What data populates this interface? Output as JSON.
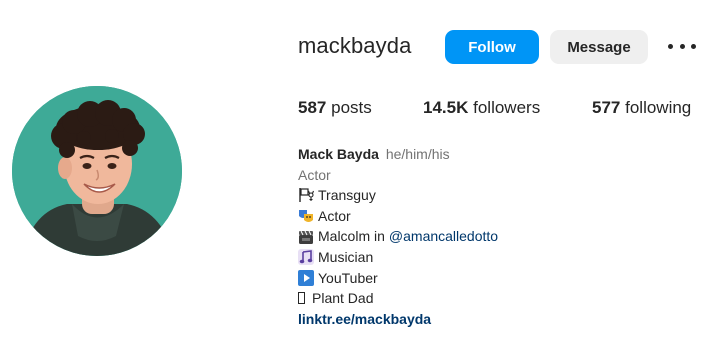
{
  "profile": {
    "username": "mackbayda",
    "follow_label": "Follow",
    "message_label": "Message",
    "stats": {
      "posts_count": "587",
      "posts_label": "posts",
      "followers_count": "14.5K",
      "followers_label": "followers",
      "following_count": "577",
      "following_label": "following"
    },
    "bio": {
      "name": "Mack Bayda",
      "pronouns": "he/him/his",
      "category": "Actor",
      "lines": [
        {
          "icon": "transgender-flag-icon",
          "text": "Transguy"
        },
        {
          "icon": "theater-masks-icon",
          "text": "Actor"
        },
        {
          "icon": "clapperboard-icon",
          "text_prefix": "Malcolm in ",
          "mention": "@amancalledotto"
        },
        {
          "icon": "music-note-icon",
          "text": "Musician"
        },
        {
          "icon": "play-button-icon",
          "text": "YouTuber"
        },
        {
          "icon": "missing-glyph-icon",
          "text": "Plant Dad"
        }
      ],
      "link": "linktr.ee/mackbayda"
    },
    "colors": {
      "accent": "#0095f6",
      "link": "#00376b",
      "secondary_text": "#737373",
      "avatar_bg": "#3aa592"
    }
  }
}
